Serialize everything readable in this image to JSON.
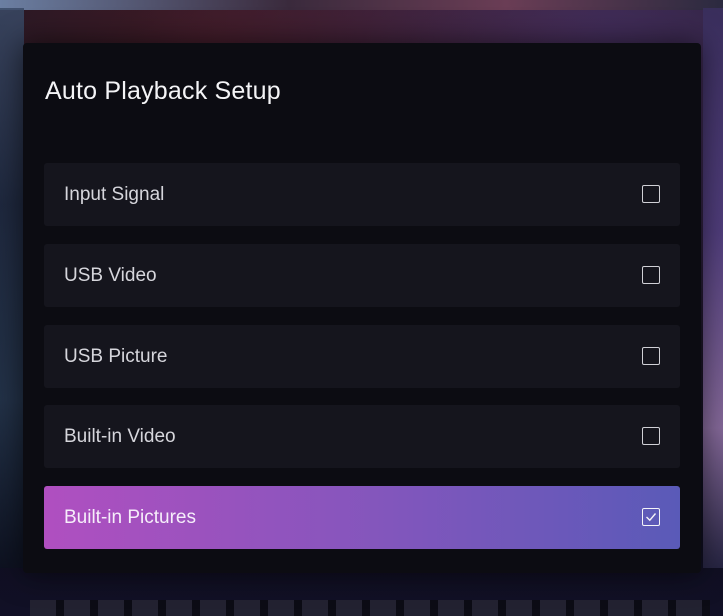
{
  "dialog": {
    "title": "Auto Playback Setup"
  },
  "options": [
    {
      "label": "Input Signal",
      "checked": false,
      "focused": false
    },
    {
      "label": "USB Video",
      "checked": false,
      "focused": false
    },
    {
      "label": "USB Picture",
      "checked": false,
      "focused": false
    },
    {
      "label": "Built-in Video",
      "checked": false,
      "focused": false
    },
    {
      "label": "Built-in Pictures",
      "checked": true,
      "focused": true
    }
  ],
  "icons": {
    "checkbox_empty": "checkbox-empty-icon",
    "checkbox_checked": "checkbox-checked-icon"
  },
  "colors": {
    "dialog_background": "#0c0c12",
    "row_background": "#15151d",
    "focus_gradient_start": "#b04fc0",
    "focus_gradient_end": "#5a5ab8",
    "text": "#d6d6dc"
  }
}
